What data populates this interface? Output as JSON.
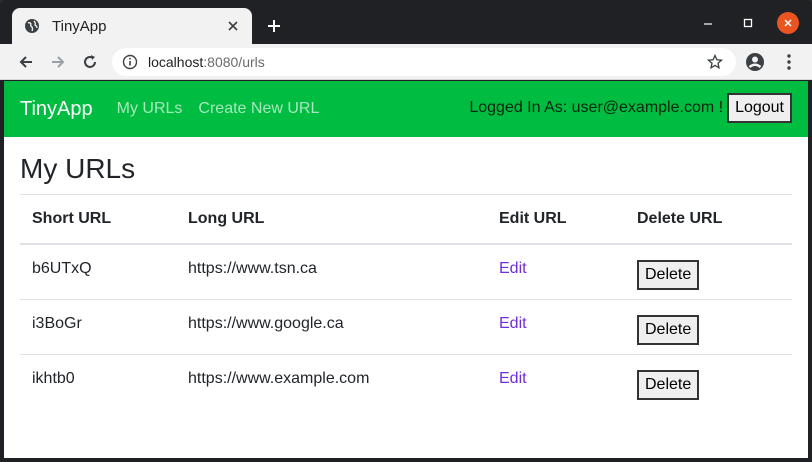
{
  "browser": {
    "tab_title": "TinyApp",
    "url_host": "localhost",
    "url_rest": ":8080/urls"
  },
  "navbar": {
    "brand": "TinyApp",
    "links": [
      "My URLs",
      "Create New URL"
    ],
    "logged_in_text": "Logged In As: user@example.com !",
    "logout_label": "Logout"
  },
  "page": {
    "title": "My URLs"
  },
  "table": {
    "headers": [
      "Short URL",
      "Long URL",
      "Edit URL",
      "Delete URL"
    ],
    "rows": [
      {
        "short": "b6UTxQ",
        "long": "https://www.tsn.ca",
        "edit": "Edit",
        "delete": "Delete"
      },
      {
        "short": "i3BoGr",
        "long": "https://www.google.ca",
        "edit": "Edit",
        "delete": "Delete"
      },
      {
        "short": "ikhtb0",
        "long": "https://www.example.com",
        "edit": "Edit",
        "delete": "Delete"
      }
    ]
  },
  "colors": {
    "navbar": "#00bc40",
    "link": "#6f2ed8",
    "close_button": "#e95420"
  }
}
